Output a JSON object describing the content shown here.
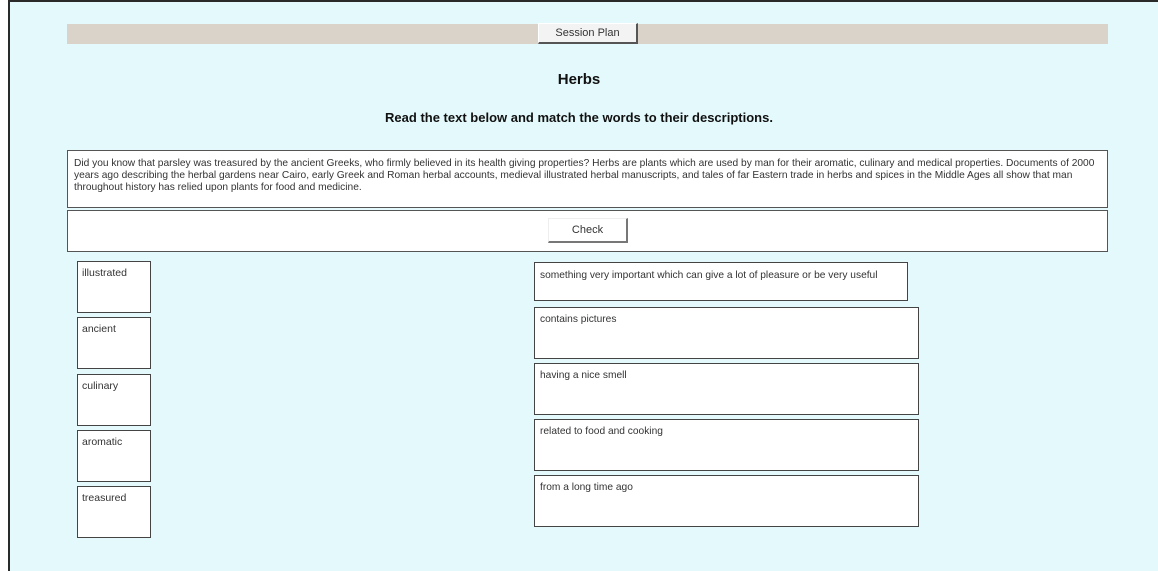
{
  "header": {
    "session_plan_label": "Session Plan"
  },
  "page": {
    "title": "Herbs",
    "instruction": "Read the text below and match the words to their descriptions."
  },
  "passage": "Did you know that parsley was treasured by the ancient Greeks, who firmly believed in its health giving properties? Herbs are plants which are used by man for their aromatic, culinary and medical properties. Documents of 2000 years ago describing the herbal gardens near Cairo, early Greek and Roman herbal accounts, medieval illustrated herbal manuscripts, and tales of far Eastern trade in herbs and spices in the Middle Ages all show that man throughout history has relied upon plants for food and medicine.",
  "check_label": "Check",
  "words": [
    "illustrated",
    "ancient",
    "culinary",
    "aromatic",
    "treasured"
  ],
  "descriptions": [
    "something very important which can give a lot of pleasure or be very useful",
    "contains pictures",
    "having a nice smell",
    "related to food and cooking",
    "from a long time ago"
  ]
}
